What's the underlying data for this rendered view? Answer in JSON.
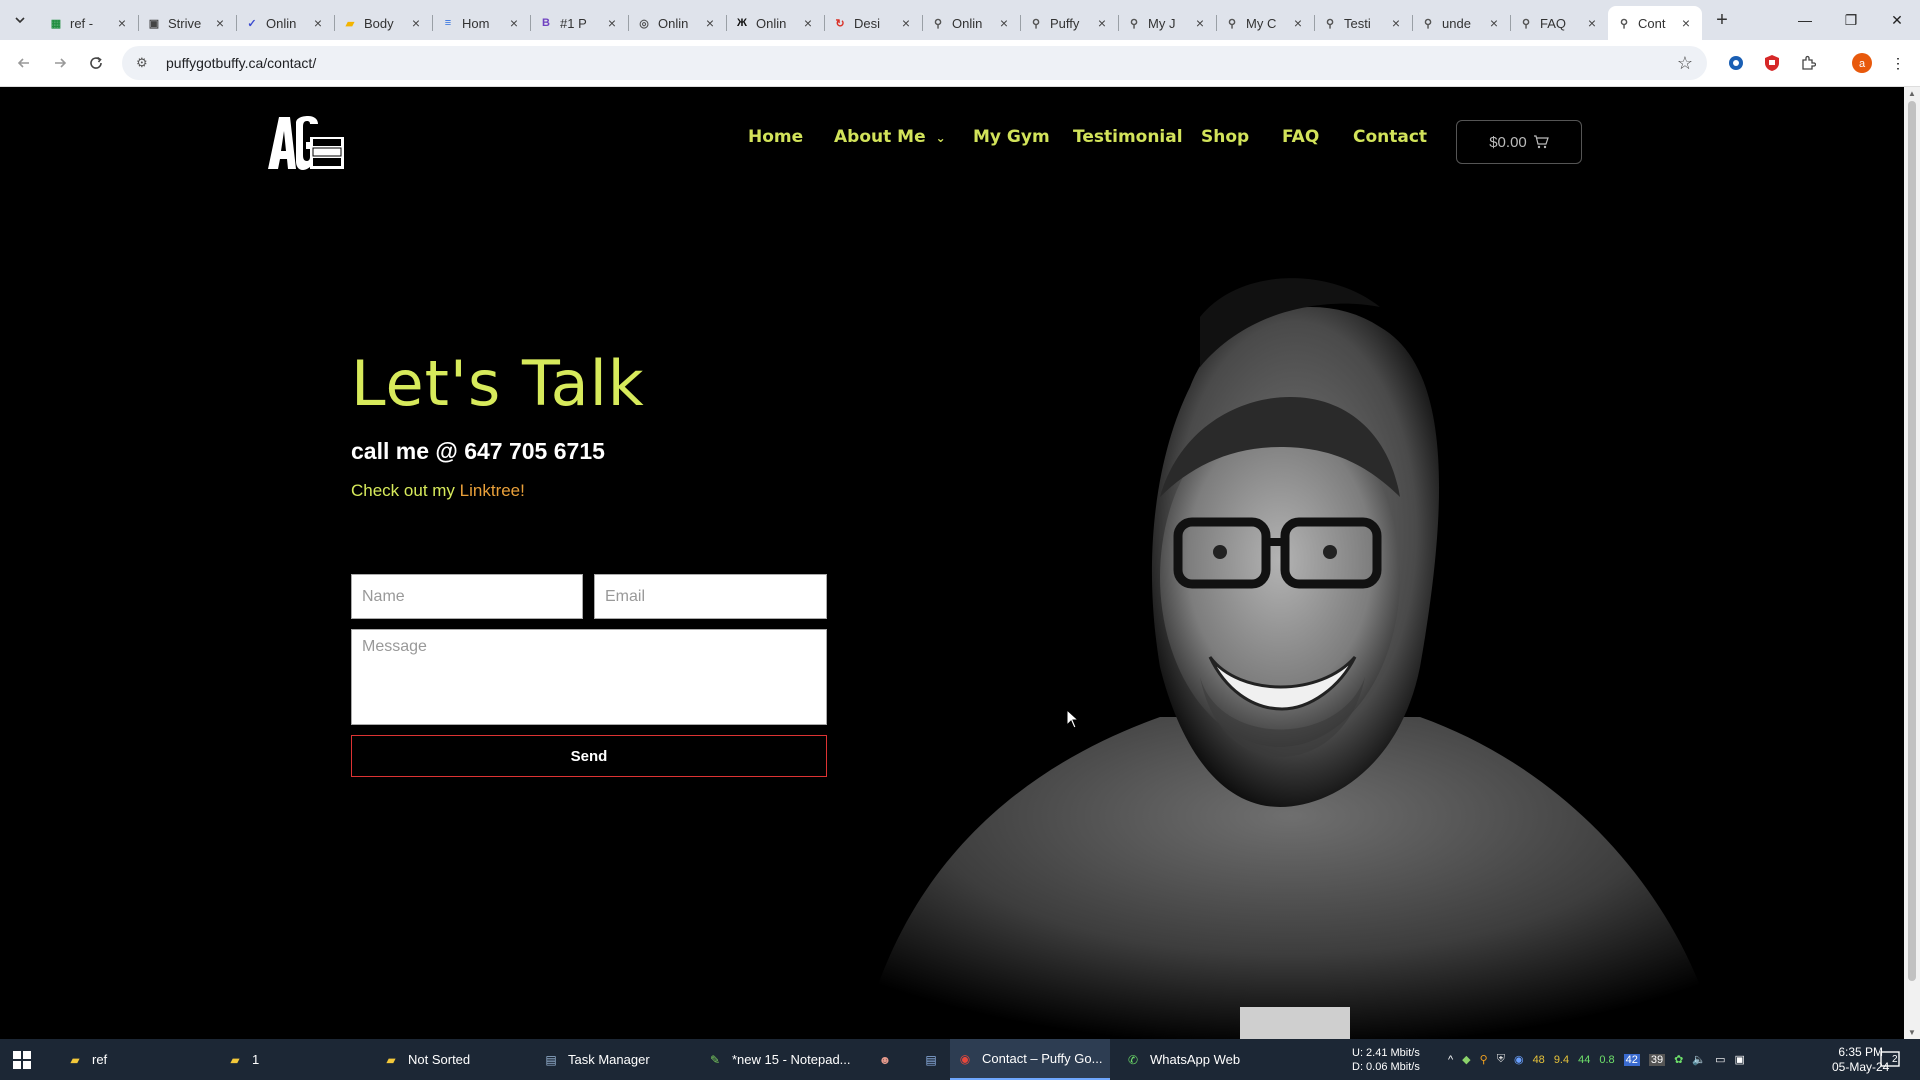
{
  "browser": {
    "tabs": [
      {
        "title": "ref -",
        "icon": "sheets-icon",
        "color": "#1e8e3e"
      },
      {
        "title": "Strive",
        "icon": "site-icon",
        "color": "#444444"
      },
      {
        "title": "Onlin",
        "icon": "check-icon",
        "color": "#3c4cd0"
      },
      {
        "title": "Body",
        "icon": "folder-icon",
        "color": "#f3b400"
      },
      {
        "title": "Hom",
        "icon": "layers-icon",
        "color": "#2f6fe0"
      },
      {
        "title": "#1 P",
        "icon": "bootstrap-icon",
        "color": "#6f42c1"
      },
      {
        "title": "Onlin",
        "icon": "circle-icon",
        "color": "#555555"
      },
      {
        "title": "Onlin",
        "icon": "x-logo-icon",
        "color": "#111111"
      },
      {
        "title": "Desi",
        "icon": "refresh-icon",
        "color": "#d93025"
      },
      {
        "title": "Onlin",
        "icon": "runner-icon",
        "color": "#555555"
      },
      {
        "title": "Puffy",
        "icon": "runner-icon",
        "color": "#555555"
      },
      {
        "title": "My J",
        "icon": "runner-icon",
        "color": "#555555"
      },
      {
        "title": "My C",
        "icon": "runner-icon",
        "color": "#555555"
      },
      {
        "title": "Testi",
        "icon": "runner-icon",
        "color": "#555555"
      },
      {
        "title": "unde",
        "icon": "runner-icon",
        "color": "#555555"
      },
      {
        "title": "FAQ",
        "icon": "runner-icon",
        "color": "#555555"
      },
      {
        "title": "Cont",
        "icon": "runner-icon",
        "color": "#555555",
        "active": true
      }
    ],
    "url": "puffygotbuffy.ca/contact/"
  },
  "site": {
    "nav": [
      {
        "label": "Home"
      },
      {
        "label": "About Me"
      },
      {
        "label": "My Gym"
      },
      {
        "label": "Testimonial"
      },
      {
        "label": "Shop"
      },
      {
        "label": "FAQ"
      },
      {
        "label": "Contact"
      }
    ],
    "cart": "$0.00",
    "accent": "#d7ea5b",
    "link_color": "#e9a03a"
  },
  "hero": {
    "title": "Let's Talk",
    "phone": "call me @ 647 705 6715",
    "link_prefix": "Check out my ",
    "link_text": "Linktree!"
  },
  "form": {
    "name_placeholder": "Name",
    "email_placeholder": "Email",
    "message_placeholder": "Message",
    "send_label": "Send",
    "send_border": "#dd3333"
  },
  "taskbar": {
    "items": [
      {
        "label": "ref",
        "icon": "folder-icon"
      },
      {
        "label": "1",
        "icon": "folder-icon"
      },
      {
        "label": "Not Sorted",
        "icon": "folder-icon"
      },
      {
        "label": "Task Manager",
        "icon": "task-manager-icon"
      },
      {
        "label": "*new 15 - Notepad...",
        "icon": "notepad-icon"
      },
      {
        "label": "Contact – Puffy Go...",
        "icon": "chrome-icon",
        "active": true
      },
      {
        "label": "WhatsApp Web",
        "icon": "whatsapp-icon"
      }
    ],
    "net_up": "U:  2.41 Mbit/s",
    "net_down": "D:  0.06 Mbit/s",
    "tray_nums": [
      "48",
      "9.4",
      "44",
      "0.8"
    ],
    "badge": "42",
    "badge2": "39",
    "time": "6:35 PM",
    "date": "05-May-24",
    "notifications": "2"
  }
}
